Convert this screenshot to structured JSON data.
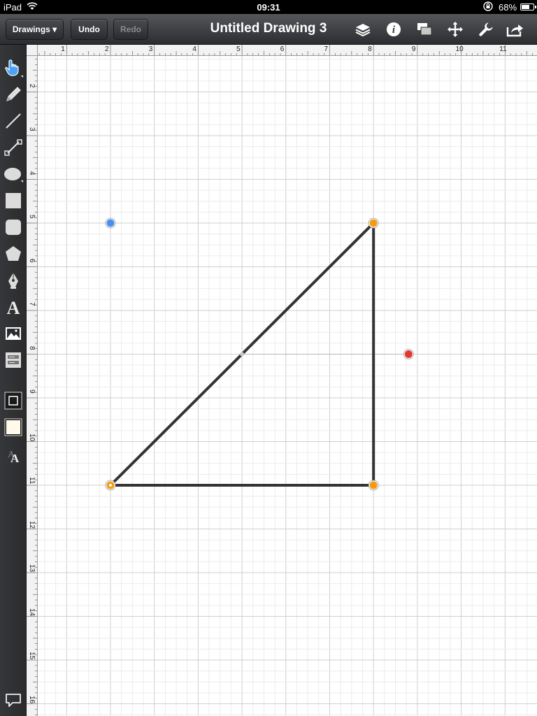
{
  "status_bar": {
    "device": "iPad",
    "time": "09:31",
    "battery": "68%"
  },
  "toolbar": {
    "drawings_label": "Drawings ▾",
    "undo_label": "Undo",
    "redo_label": "Redo",
    "title": "Untitled Drawing 3",
    "icons": [
      "layers-icon",
      "info-icon",
      "arrange-icon",
      "move-icon",
      "wrench-icon",
      "share-icon"
    ]
  },
  "palette": {
    "tools": [
      "selection-hand-icon",
      "pencil-icon",
      "line-icon",
      "connector-line-icon",
      "ellipse-icon",
      "rectangle-icon",
      "rounded-rectangle-icon",
      "polygon-icon",
      "pen-bezier-icon",
      "text-icon",
      "image-icon",
      "form-icon"
    ],
    "bottom": [
      "stroke-style-icon",
      "fill-style-icon",
      "font-style-icon",
      "comment-icon"
    ]
  },
  "rulers": {
    "top": [
      "1",
      "2",
      "3",
      "4",
      "5",
      "6",
      "7",
      "8",
      "9",
      "10",
      "11"
    ],
    "left": [
      "2",
      "3",
      "4",
      "5",
      "6",
      "7",
      "8",
      "9",
      "10",
      "11",
      "12",
      "13",
      "14",
      "15",
      "16"
    ]
  },
  "drawing": {
    "triangle": [
      [
        2,
        11
      ],
      [
        8,
        5
      ],
      [
        8,
        11
      ]
    ],
    "stroke_color": "#333333",
    "vertex_handle_color": "#f39c12",
    "guide_point_blue": [
      2,
      5
    ],
    "guide_point_red": [
      8.8,
      8
    ],
    "midpoint": [
      5,
      8
    ],
    "blue_color": "#4a8ff0",
    "red_color": "#e03a2f"
  }
}
